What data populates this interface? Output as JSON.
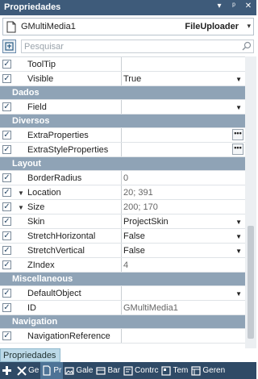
{
  "panel": {
    "title": "Propriedades",
    "controls": [
      "▾",
      "ᵖ",
      "✕"
    ]
  },
  "object": {
    "name": "GMultiMedia1",
    "type": "FileUploader",
    "chevron": "▾"
  },
  "search": {
    "placeholder": "Pesquisar"
  },
  "rows": {
    "tooltip": {
      "label": "ToolTip",
      "value": ""
    },
    "visible": {
      "label": "Visible",
      "value": "True"
    },
    "cat_dados": "Dados",
    "field": {
      "label": "Field",
      "value": ""
    },
    "cat_diversos": "Diversos",
    "extraprops": {
      "label": "ExtraProperties",
      "value": ""
    },
    "extrastyle": {
      "label": "ExtraStyleProperties",
      "value": ""
    },
    "cat_layout": "Layout",
    "borderradius": {
      "label": "BorderRadius",
      "value": "0"
    },
    "location": {
      "label": "Location",
      "value": "20; 391"
    },
    "size": {
      "label": "Size",
      "value": "200; 170"
    },
    "skin": {
      "label": "Skin",
      "value": "ProjectSkin"
    },
    "stretchh": {
      "label": "StretchHorizontal",
      "value": "False"
    },
    "stretchv": {
      "label": "StretchVertical",
      "value": "False"
    },
    "zindex": {
      "label": "ZIndex",
      "value": "4"
    },
    "cat_misc": "Miscellaneous",
    "defaultobject": {
      "label": "DefaultObject",
      "value": ""
    },
    "id": {
      "label": "ID",
      "value": "GMultiMedia1"
    },
    "cat_nav": "Navigation",
    "navref": {
      "label": "NavigationReference",
      "value": ""
    }
  },
  "bottom_tab": "Propriedades",
  "taskbar": [
    {
      "label": "",
      "icon": "plus-icon"
    },
    {
      "label": "Ge",
      "icon": "tools-icon"
    },
    {
      "label": "Pr",
      "icon": "page-icon"
    },
    {
      "label": "Gale",
      "icon": "gallery-icon"
    },
    {
      "label": "Bar",
      "icon": "bar-icon"
    },
    {
      "label": "Contrc",
      "icon": "control-icon"
    },
    {
      "label": "Tem",
      "icon": "template-icon"
    },
    {
      "label": "Geren",
      "icon": "manager-icon"
    }
  ],
  "colors": {
    "titlebar": "#3e5b7a",
    "category": "#8fa3b6",
    "taskbar": "#2f4a66",
    "tab": "#bcd9e8"
  }
}
